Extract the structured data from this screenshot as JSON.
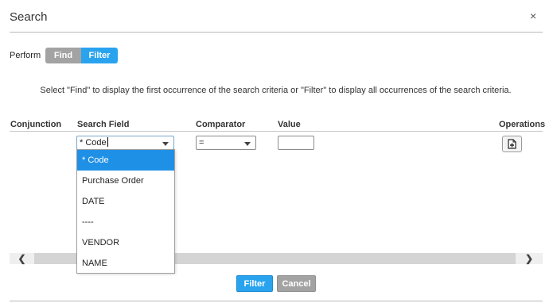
{
  "dialog": {
    "title": "Search",
    "close_glyph": "×"
  },
  "perform": {
    "label": "Perform",
    "options": [
      {
        "label": "Find",
        "active": false
      },
      {
        "label": "Filter",
        "active": true
      }
    ]
  },
  "hint": "Select \"Find\" to display the first occurrence of the search criteria or \"Filter\" to display all occurrences of the search criteria.",
  "columns": {
    "conjunction": "Conjunction",
    "search_field": "Search Field",
    "comparator": "Comparator",
    "value": "Value",
    "operations": "Operations"
  },
  "row": {
    "search_field_value": "* Code",
    "comparator_value": "=",
    "value": ""
  },
  "dropdown": {
    "options": [
      "* Code",
      "Purchase Order",
      "DATE",
      "----",
      "VENDOR",
      "NAME"
    ],
    "selected_index": 0
  },
  "scrollbar": {
    "left_glyph": "❮",
    "right_glyph": "❯"
  },
  "buttons": {
    "filter": "Filter",
    "cancel": "Cancel"
  },
  "icons": {
    "operations": "add-document-icon",
    "close": "close-icon"
  },
  "colors": {
    "accent": "#2aa3ef",
    "inactive": "#a3a3a3",
    "selected_item": "#1e90e6"
  }
}
